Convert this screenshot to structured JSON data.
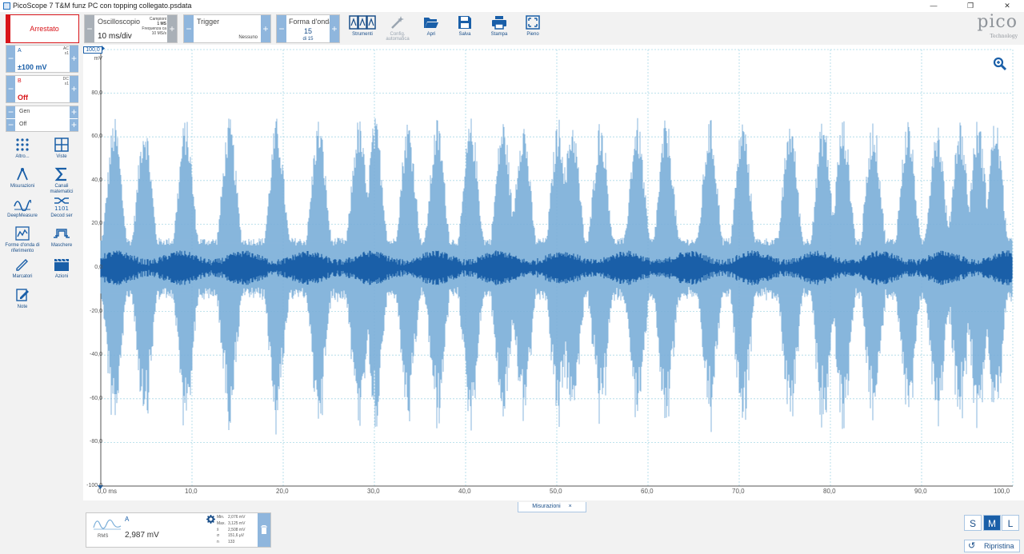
{
  "window": {
    "title": "PicoScope 7 T&M funz PC con topping collegato.psdata"
  },
  "toolbar": {
    "run_state": "Arrestato",
    "scope_title": "Oscilloscopio",
    "timebase": "10 ms/div",
    "samples_label": "Campioni",
    "samples_value": "1 MS",
    "freq_label": "Frequenza ca",
    "freq_value": "10 MS/s",
    "trigger_title": "Trigger",
    "trigger_value": "Nessuno",
    "waveform_title": "Forma d'onda",
    "waveform_value": "15",
    "waveform_of": "di 15",
    "buttons": {
      "tools": "Strumenti",
      "autoconfig": "Config. automatica",
      "open": "Apri",
      "save": "Salva",
      "print": "Stampa",
      "full": "Pieno"
    },
    "brand": "pico",
    "brand_sub": "Technology"
  },
  "channels": [
    {
      "name": "A",
      "coupling": "AC",
      "probe": "x1",
      "range": "±100 mV",
      "color": "#1a5fa8"
    },
    {
      "name": "B",
      "coupling": "DC",
      "probe": "x1",
      "range": "Off",
      "color": "#d9151a"
    }
  ],
  "generator": {
    "label": "Gen",
    "state": "Off"
  },
  "tools": [
    {
      "label": "Altro...",
      "icon": "grid-dots-icon"
    },
    {
      "label": "Viste",
      "icon": "views-icon"
    },
    {
      "label": "Misurazioni",
      "icon": "measure-icon"
    },
    {
      "label": "Canali matematici",
      "icon": "sigma-icon"
    },
    {
      "label": "DeepMeasure",
      "icon": "deepmeasure-icon"
    },
    {
      "label": "Decod ser",
      "icon": "serial-decode-icon"
    },
    {
      "label": "Forme d'onda di riferimento",
      "icon": "reference-waveform-icon"
    },
    {
      "label": "Maschere",
      "icon": "mask-icon"
    },
    {
      "label": "Marcatori",
      "icon": "marker-icon"
    },
    {
      "label": "Azioni",
      "icon": "actions-icon"
    },
    {
      "label": "Note",
      "icon": "notes-icon"
    }
  ],
  "plot": {
    "y_unit_top": "100,0",
    "y_unit": "mV",
    "y_ticks": [
      "80,0",
      "60,0",
      "40,0",
      "20,0",
      "0,0",
      "-20,0",
      "-40,0",
      "-60,0",
      "-80,0",
      "-100,0"
    ],
    "x_ticks": [
      "0,0 ms",
      "10,0",
      "20,0",
      "30,0",
      "40,0",
      "50,0",
      "60,0",
      "70,0",
      "80,0",
      "90,0",
      "100,0"
    ],
    "trace_color": "#1a5fa8",
    "trace_light": "#7aaed9"
  },
  "measurements": {
    "tab_label": "Misurazioni",
    "type": "RMS",
    "channel": "A",
    "value": "2,987 mV",
    "stats": [
      {
        "k": "Min.",
        "v": "2,076 mV"
      },
      {
        "k": "Max.",
        "v": "3,125 mV"
      },
      {
        "k": "x̄",
        "v": "2,508 mV"
      },
      {
        "k": "σ",
        "v": "151,6 µV"
      },
      {
        "k": "n",
        "v": "133"
      }
    ]
  },
  "size_buttons": [
    "S",
    "M",
    "L"
  ],
  "reset_label": "Ripristina"
}
